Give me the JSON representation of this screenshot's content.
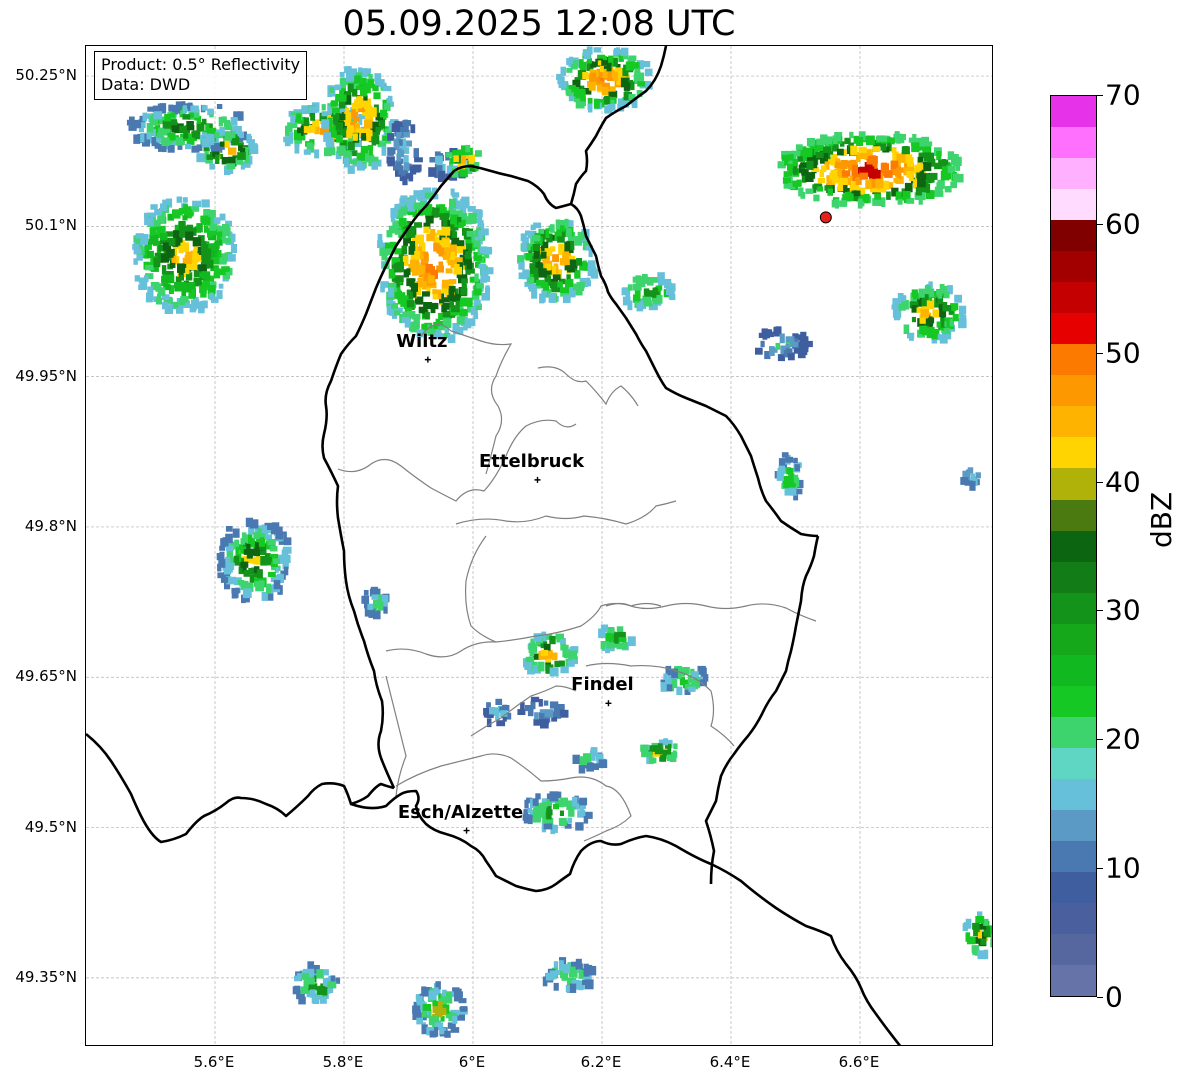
{
  "title": "05.09.2025 12:08 UTC",
  "info_box": {
    "product": "Product: 0.5° Reflectivity",
    "data": "Data: DWD"
  },
  "map_extent": {
    "lon": [
      5.4,
      6.8
    ],
    "lat": [
      49.3,
      50.3
    ]
  },
  "lat_ticks": [
    {
      "value": 50.25,
      "label": "50.25°N"
    },
    {
      "value": 50.1,
      "label": "50.1°N"
    },
    {
      "value": 49.95,
      "label": "49.95°N"
    },
    {
      "value": 49.8,
      "label": "49.8°N"
    },
    {
      "value": 49.65,
      "label": "49.65°N"
    },
    {
      "value": 49.5,
      "label": "49.5°N"
    },
    {
      "value": 49.35,
      "label": "49.35°N"
    }
  ],
  "lon_ticks": [
    {
      "value": 5.6,
      "label": "5.6°E"
    },
    {
      "value": 5.8,
      "label": "5.8°E"
    },
    {
      "value": 6.0,
      "label": "6°E"
    },
    {
      "value": 6.2,
      "label": "6.2°E"
    },
    {
      "value": 6.4,
      "label": "6.4°E"
    },
    {
      "value": 6.6,
      "label": "6.6°E"
    }
  ],
  "cities": [
    {
      "name": "Wiltz",
      "lon": 5.93,
      "lat": 49.967
    },
    {
      "name": "Ettelbruck",
      "lon": 6.1,
      "lat": 49.847
    },
    {
      "name": "Findel",
      "lon": 6.21,
      "lat": 49.624
    },
    {
      "name": "Esch/Alzette",
      "lon": 5.99,
      "lat": 49.497
    }
  ],
  "radar_site": {
    "lon": 6.547,
    "lat": 50.109,
    "color": "#e8201c"
  },
  "colorbar": {
    "label": "dBZ",
    "min": 0,
    "max": 70,
    "step": 2.5,
    "ticks": [
      {
        "value": 0,
        "label": "0"
      },
      {
        "value": 10,
        "label": "10"
      },
      {
        "value": 20,
        "label": "20"
      },
      {
        "value": 30,
        "label": "30"
      },
      {
        "value": 40,
        "label": "40"
      },
      {
        "value": 50,
        "label": "50"
      },
      {
        "value": 60,
        "label": "60"
      },
      {
        "value": 70,
        "label": "70"
      }
    ],
    "colors": [
      "#6673a8",
      "#56669f",
      "#4a5f9e",
      "#3f5e9f",
      "#4a78b0",
      "#5a9ac4",
      "#66c0da",
      "#5fd6c4",
      "#3dd46e",
      "#16c824",
      "#12b820",
      "#14a81a",
      "#13931a",
      "#127d16",
      "#0c6510",
      "#4a7a10",
      "#b0b20a",
      "#ffd400",
      "#fdb300",
      "#fd9800",
      "#fd7a00",
      "#e60000",
      "#c40000",
      "#a20000",
      "#800000",
      "#ffdcff",
      "#ffb0ff",
      "#ff70ff",
      "#e633ea"
    ]
  },
  "colors": {
    "border": "#000000",
    "cantons": "#808080",
    "grid": "#b4b4b4"
  }
}
